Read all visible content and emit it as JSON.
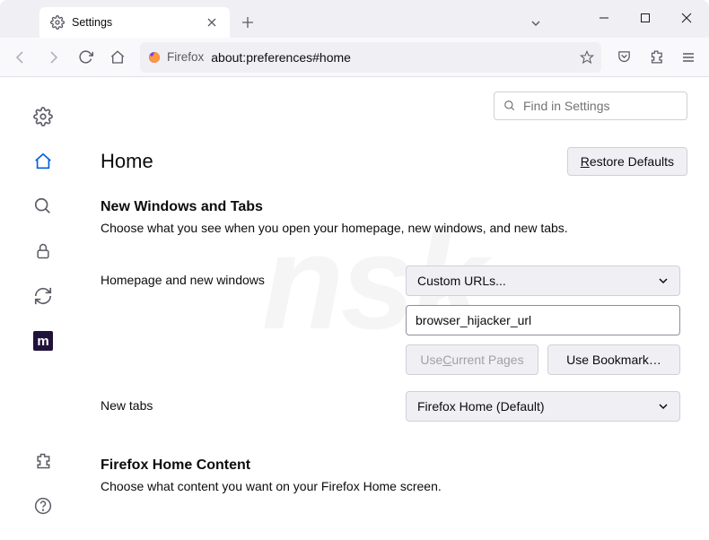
{
  "tab": {
    "title": "Settings"
  },
  "urlbar": {
    "identity": "Firefox",
    "url": "about:preferences#home"
  },
  "search": {
    "placeholder": "Find in Settings"
  },
  "page": {
    "title": "Home",
    "restore_label": "Restore Defaults",
    "section1_title": "New Windows and Tabs",
    "section1_desc": "Choose what you see when you open your homepage, new windows, and new tabs.",
    "homepage_label": "Homepage and new windows",
    "homepage_select": "Custom URLs...",
    "homepage_value": "browser_hijacker_url",
    "use_current": "Use Current Pages",
    "use_bookmark": "Use Bookmark…",
    "newtabs_label": "New tabs",
    "newtabs_select": "Firefox Home (Default)",
    "section2_title": "Firefox Home Content",
    "section2_desc": "Choose what content you want on your Firefox Home screen."
  }
}
